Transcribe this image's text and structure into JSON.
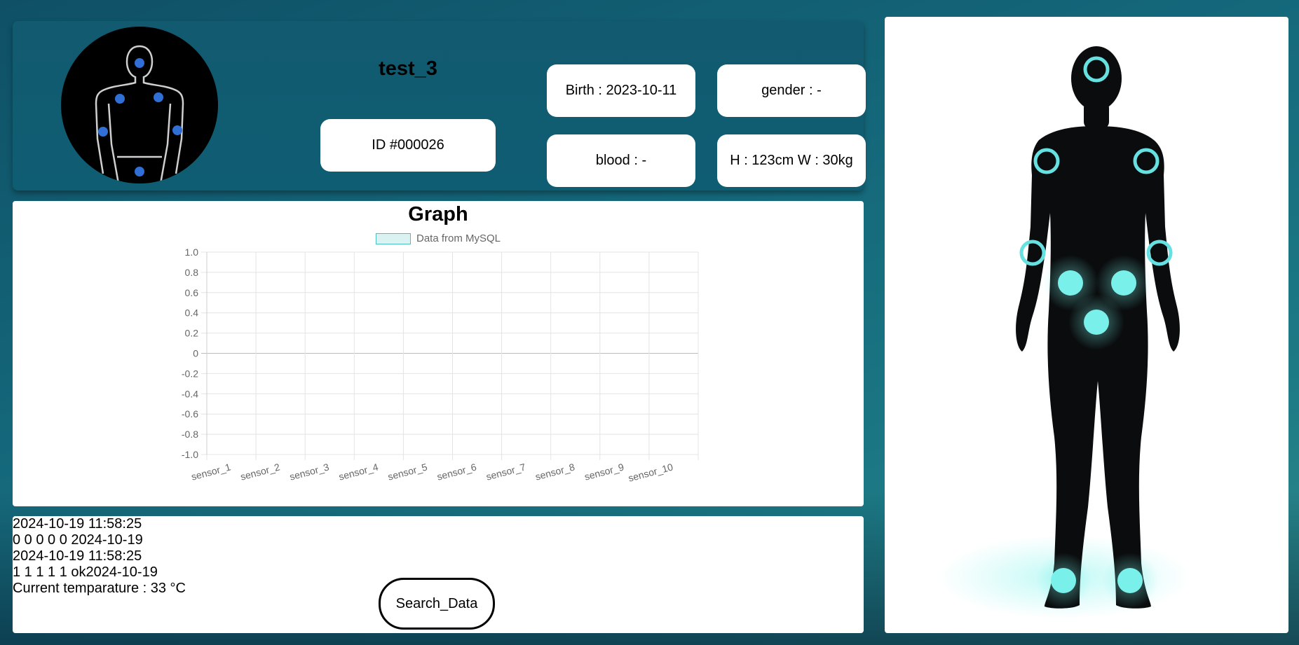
{
  "patient": {
    "name": "test_3",
    "id": "ID #000026",
    "birth": "Birth : 2023-10-11",
    "gender": "gender : -",
    "blood": "blood : -",
    "height_weight": "H : 123cm W : 30kg"
  },
  "graph": {
    "title": "Graph"
  },
  "chart_data": {
    "type": "bar",
    "title": "Graph",
    "categories": [
      "sensor_1",
      "sensor_2",
      "sensor_3",
      "sensor_4",
      "sensor_5",
      "sensor_6",
      "sensor_7",
      "sensor_8",
      "sensor_9",
      "sensor_10"
    ],
    "series": [
      {
        "name": "Data from MySQL",
        "values": [
          0,
          0,
          0,
          0,
          0,
          0,
          0,
          0,
          0,
          0
        ],
        "color": "#4bc0c0"
      }
    ],
    "yticks": [
      "1.0",
      "0.8",
      "0.6",
      "0.4",
      "0.2",
      "0",
      "-0.2",
      "-0.4",
      "-0.6",
      "-0.8",
      "-1.0"
    ],
    "ylim": [
      -1,
      1
    ],
    "grid": true,
    "legend": "top"
  },
  "data_log": {
    "lines": [
      "2024-10-19 11:58:25",
      "0 0 0 0 0 2024-10-19",
      "2024-10-19 11:58:25",
      "1 1 1 1 1 ok2024-10-19",
      "Current temparature : 33 °C"
    ],
    "search_label": "Search_Data"
  },
  "body_map": {
    "ring_color": "#66e0e0",
    "dot_color": "#79f0ea"
  }
}
